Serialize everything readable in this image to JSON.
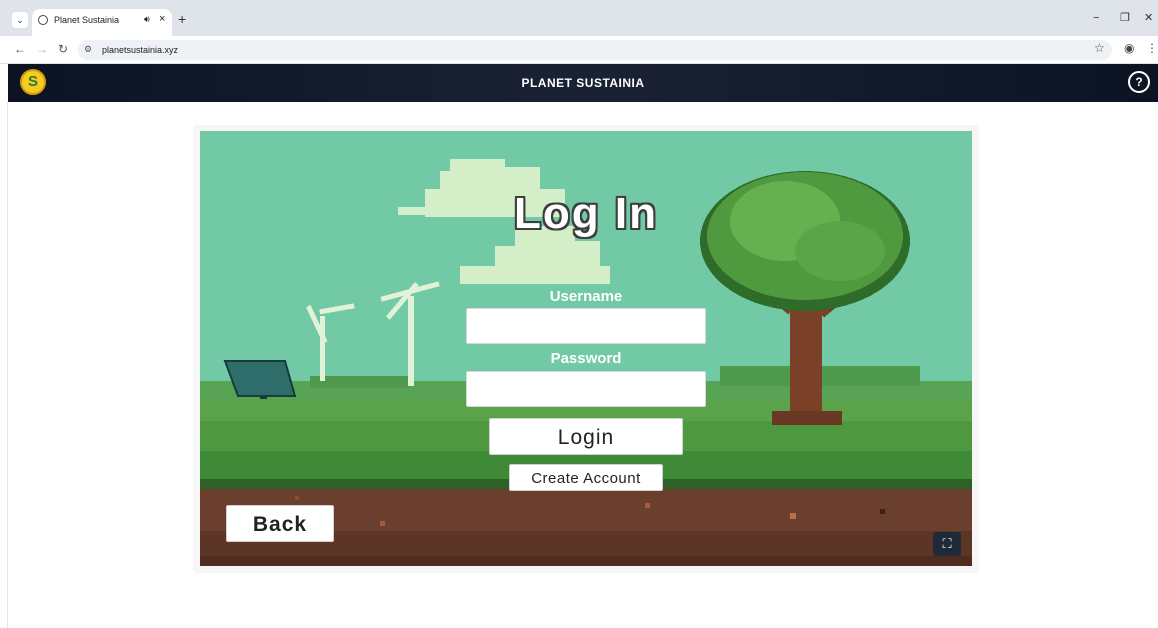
{
  "browser": {
    "tab_title": "Planet Sustainia",
    "url": "planetsustainia.xyz",
    "new_tab_symbol": "+",
    "tab_close_symbol": "×"
  },
  "header": {
    "title": "PLANET SUSTAINIA",
    "help_label": "?"
  },
  "login": {
    "title": "Log In",
    "username_label": "Username",
    "username_value": "",
    "password_label": "Password",
    "password_value": "",
    "login_button": "Login",
    "create_account_button": "Create Account",
    "back_button": "Back"
  },
  "colors": {
    "sky": "#71c9a6",
    "header_bg": "#0c1322",
    "grass": "#5aa34a",
    "soil": "#6b3f2e"
  }
}
